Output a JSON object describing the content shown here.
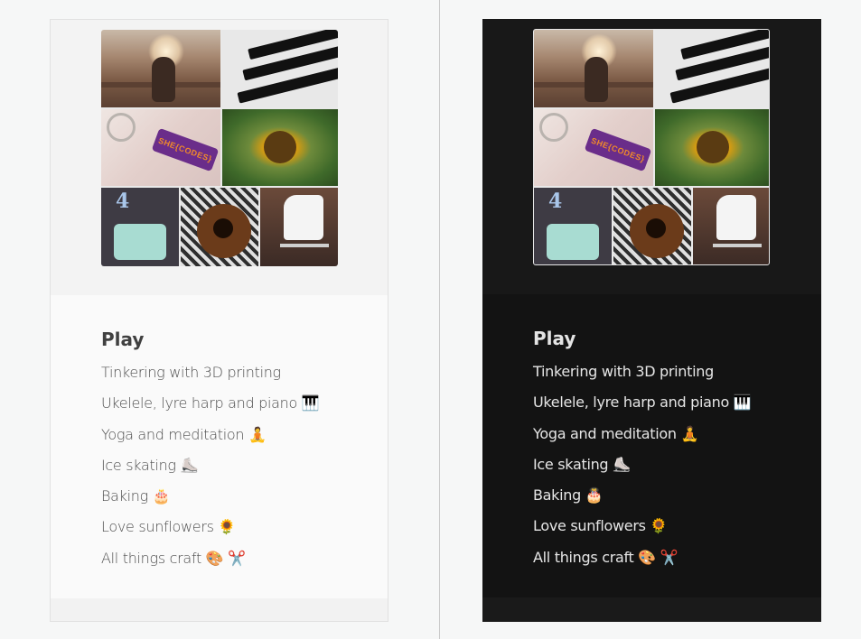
{
  "section": {
    "heading": "Play",
    "items": [
      "Tinkering with 3D printing",
      "Ukelele, lyre harp and piano 🎹",
      "Yoga and meditation 🧘",
      "Ice skating ⛸️",
      "Baking 🎂",
      "Love sunflowers 🌻",
      "All things craft 🎨 ✂️"
    ]
  },
  "collage": {
    "keytag_text": "SHE{CODES}"
  },
  "themes": {
    "light": {
      "background": "#fafafa",
      "text": "#4d4d4d"
    },
    "dark": {
      "background": "#131313",
      "text": "#e6e6e6"
    }
  }
}
